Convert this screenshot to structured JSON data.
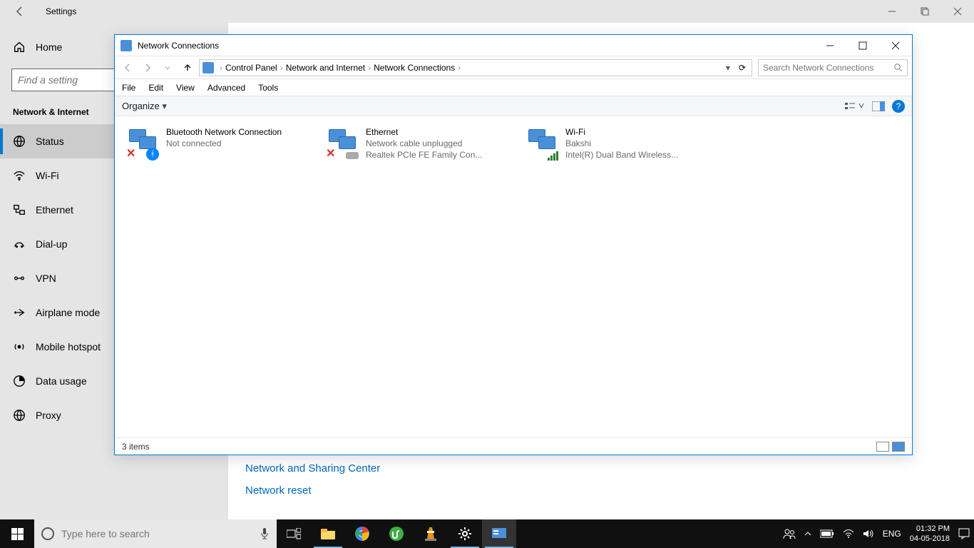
{
  "settings": {
    "title": "Settings",
    "home_label": "Home",
    "search_placeholder": "Find a setting",
    "section_label": "Network & Internet",
    "items": [
      {
        "label": "Status"
      },
      {
        "label": "Wi-Fi"
      },
      {
        "label": "Ethernet"
      },
      {
        "label": "Dial-up"
      },
      {
        "label": "VPN"
      },
      {
        "label": "Airplane mode"
      },
      {
        "label": "Mobile hotspot"
      },
      {
        "label": "Data usage"
      },
      {
        "label": "Proxy"
      }
    ],
    "related": [
      "Network and Sharing Center",
      "Network reset"
    ]
  },
  "explorer": {
    "title": "Network Connections",
    "breadcrumb": [
      "Control Panel",
      "Network and Internet",
      "Network Connections"
    ],
    "breadcrumb_dropdown": "▾",
    "refresh_icon": "⟳",
    "search_placeholder": "Search Network Connections",
    "menu": [
      "File",
      "Edit",
      "View",
      "Advanced",
      "Tools"
    ],
    "organize_label": "Organize",
    "connections": [
      {
        "name": "Bluetooth Network Connection",
        "line2": "Not connected",
        "line3": "",
        "status": "x",
        "overlay": "bt"
      },
      {
        "name": "Ethernet",
        "line2": "Network cable unplugged",
        "line3": "Realtek PCIe FE Family Con...",
        "status": "x",
        "overlay": "plug"
      },
      {
        "name": "Wi-Fi",
        "line2": "Bakshi",
        "line3": "Intel(R) Dual Band Wireless...",
        "status": "ok",
        "overlay": "sig"
      }
    ],
    "status_text": "3 items"
  },
  "taskbar": {
    "search_placeholder": "Type here to search",
    "lang": "ENG",
    "time": "01:32 PM",
    "date": "04-05-2018"
  }
}
